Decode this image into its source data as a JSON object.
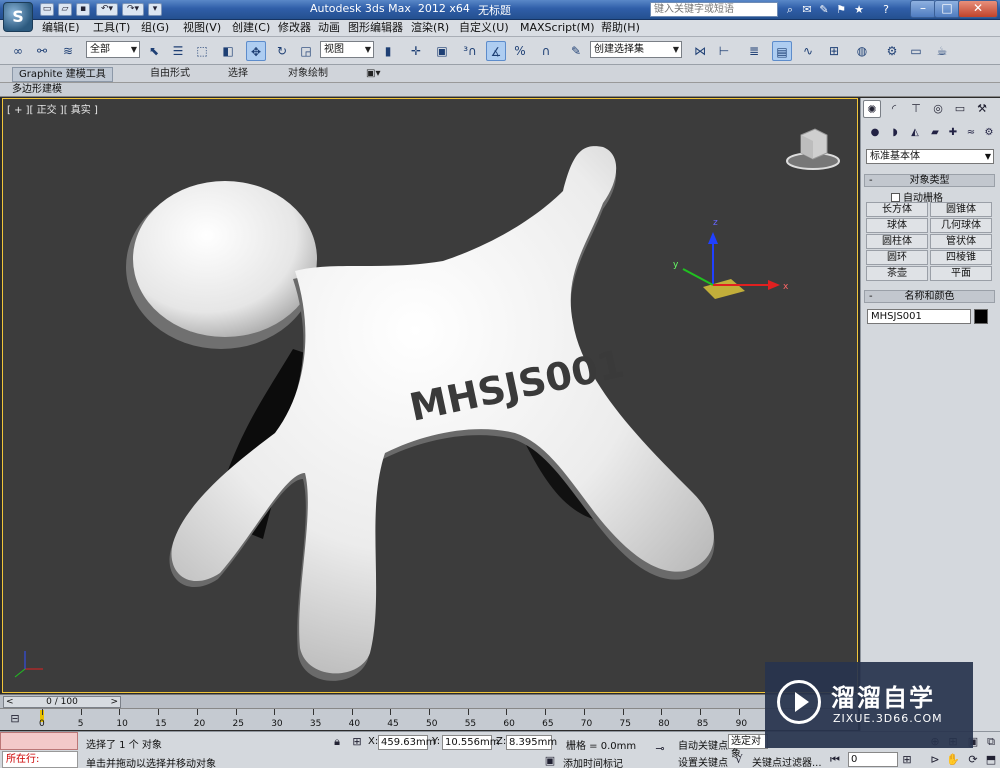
{
  "titlebar": {
    "app_title": "Autodesk 3ds Max  2012 x64",
    "file_name": "无标题",
    "search_placeholder": "键入关键字或短语",
    "logo_text": "S"
  },
  "menubar": [
    "编辑(E)",
    "工具(T)",
    "组(G)",
    "视图(V)",
    "创建(C)",
    "修改器",
    "动画",
    "图形编辑器",
    "渲染(R)",
    "自定义(U)",
    "MAXScript(M)",
    "帮助(H)"
  ],
  "toolbar": {
    "selection_filter": "全部",
    "reference_coord": "视图",
    "named_selection": "创建选择集"
  },
  "ribbon": {
    "tabs": [
      "Graphite 建模工具",
      "自由形式",
      "选择",
      "对象绘制"
    ],
    "sub_label": "多边形建模"
  },
  "viewport": {
    "label": "[ + ][ 正交 ][ 真实 ]",
    "model_text": "MHSJS001",
    "axis_x": "x",
    "axis_y": "y",
    "axis_z": "z"
  },
  "command_panel": {
    "category": "标准基本体",
    "object_type_header": "对象类型",
    "autogrid_label": "自动栅格",
    "primitives": [
      "长方体",
      "圆锥体",
      "球体",
      "几何球体",
      "圆柱体",
      "管状体",
      "圆环",
      "四棱锥",
      "茶壶",
      "平面"
    ],
    "name_color_header": "名称和颜色",
    "object_name": "MHSJS001"
  },
  "timeline": {
    "frame_display": "0 / 100",
    "ticks": [
      "0",
      "5",
      "10",
      "15",
      "20",
      "25",
      "30",
      "35",
      "40",
      "45",
      "50",
      "55",
      "60",
      "65",
      "70",
      "75",
      "80",
      "85",
      "90"
    ]
  },
  "statusbar": {
    "running_label": "所在行:",
    "selection_status": "选择了 1 个 对象",
    "prompt": "单击并拖动以选择并移动对象",
    "x_label": "X:",
    "x_value": "459.63mm",
    "y_label": "Y:",
    "y_value": "10.556mm",
    "z_label": "Z:",
    "z_value": "8.395mm",
    "grid": "栅格 = 0.0mm",
    "add_time_tag": "添加时间标记",
    "auto_key": "自动关键点",
    "selected_dropdown": "选定对象",
    "set_key": "设置关键点",
    "key_filters": "关键点过滤器...",
    "frame_field": "0"
  },
  "watermark": {
    "title": "溜溜自学",
    "url": "ZIXUE.3D66.COM"
  },
  "colors": {
    "viewport_bg": "#3c3c3c",
    "viewport_border": "#f2c63a",
    "title_bar": "#2f5ea8"
  }
}
